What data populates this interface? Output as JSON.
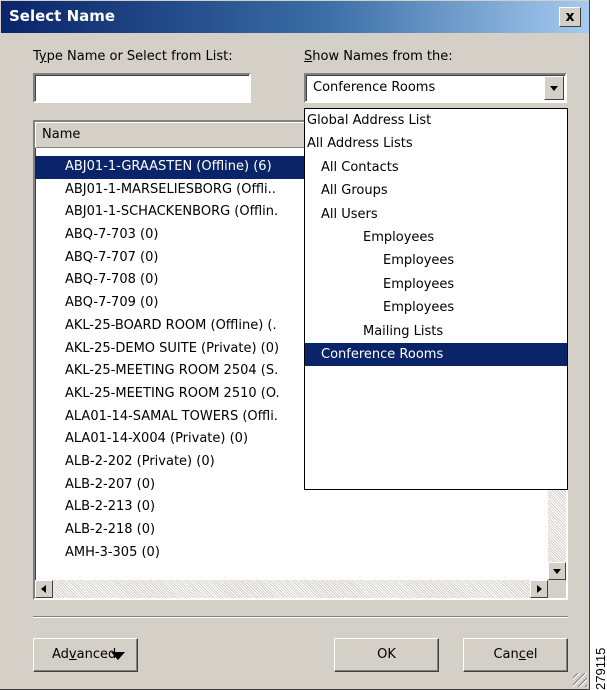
{
  "window": {
    "title": "Select Name",
    "close_label": "x"
  },
  "name_input": {
    "label_pre": "T",
    "label_ul": "y",
    "label_post": "pe Name or Select from List:",
    "value": ""
  },
  "show_names": {
    "label_ul": "S",
    "label_post": "how Names from the:",
    "selected": "Conference Rooms"
  },
  "list": {
    "column_name": "Name",
    "rows": [
      "ABJ01-1-GRAASTEN (Offline) (6)",
      "ABJ01-1-MARSELIESBORG (Offli..",
      "ABJ01-1-SCHACKENBORG (Offlin.",
      "ABQ-7-703 (0)",
      "ABQ-7-707 (0)",
      "ABQ-7-708 (0)",
      "ABQ-7-709 (0)",
      "AKL-25-BOARD ROOM (Offline) (.",
      "AKL-25-DEMO SUITE (Private) (0)",
      "AKL-25-MEETING ROOM 2504 (S.",
      "AKL-25-MEETING ROOM 2510 (O.",
      "ALA01-14-SAMAL TOWERS (Offli.",
      "ALA01-14-X004 (Private) (0)",
      "ALB-2-202 (Private) (0)",
      "ALB-2-207 (0)",
      "ALB-2-213 (0)",
      "ALB-2-218 (0)",
      "AMH-3-305 (0)"
    ],
    "selected_index": 0
  },
  "dropdown": {
    "items": [
      "Global Address List",
      "All Address Lists",
      "All Contacts",
      "All Groups",
      "All Users",
      "Employees",
      "Employees",
      "Employees",
      "Employees",
      "Mailing Lists",
      "Conference Rooms"
    ],
    "selected_index": 10
  },
  "buttons": {
    "advanced_pre": "Ad",
    "advanced_ul": "v",
    "advanced_post": "anced",
    "ok": "OK",
    "cancel_pre": "Can",
    "cancel_ul": "c",
    "cancel_post": "el"
  },
  "figure_id": "279115",
  "colors": {
    "selection": "#0a246a",
    "face": "#d4d0c8"
  }
}
